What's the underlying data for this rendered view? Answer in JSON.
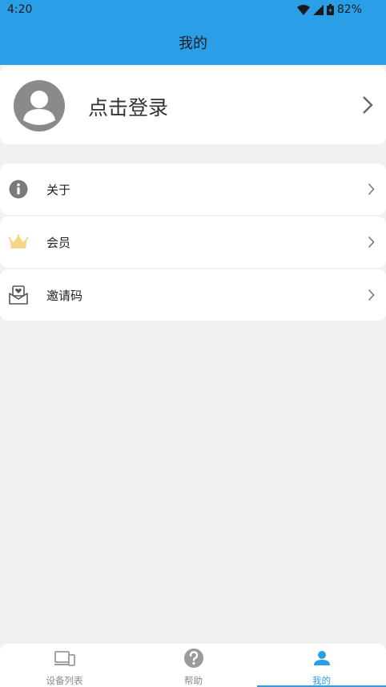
{
  "status_bar": {
    "time": "4:20",
    "battery": "82%",
    "icons": [
      "wifi-icon",
      "signal-icon",
      "battery-icon"
    ]
  },
  "header": {
    "title": "我的"
  },
  "profile": {
    "login_label": "点击登录",
    "avatar_icon": "avatar-icon"
  },
  "menu": {
    "items": [
      {
        "label": "关于",
        "icon": "info-icon"
      },
      {
        "label": "会员",
        "icon": "crown-icon"
      },
      {
        "label": "邀请码",
        "icon": "envelope-heart-icon"
      }
    ]
  },
  "tabbar": {
    "tabs": [
      {
        "label": "设备列表",
        "icon": "devices-icon",
        "active": false
      },
      {
        "label": "帮助",
        "icon": "help-icon",
        "active": false
      },
      {
        "label": "我的",
        "icon": "user-icon",
        "active": true
      }
    ]
  },
  "colors": {
    "accent": "#2a9ee6",
    "background": "#f0f1f3",
    "crown": "#f6d58a"
  }
}
